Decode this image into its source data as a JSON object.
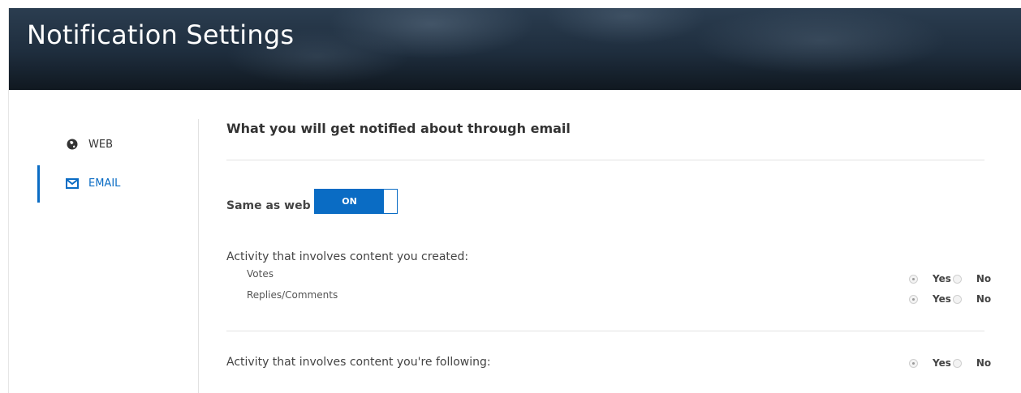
{
  "header": {
    "title": "Notification Settings"
  },
  "sidebar": {
    "items": [
      {
        "label": "WEB",
        "icon": "globe-icon",
        "active": false
      },
      {
        "label": "EMAIL",
        "icon": "envelope-icon",
        "active": true
      }
    ]
  },
  "main": {
    "section_title": "What you will get notified about through email",
    "same_as_web": {
      "label": "Same as web",
      "toggle_state": "ON"
    },
    "groups": [
      {
        "label": "Activity that involves content you created:",
        "options": [
          {
            "label": "Votes",
            "yes": "Yes",
            "no": "No",
            "selected": "Yes"
          },
          {
            "label": "Replies/Comments",
            "yes": "Yes",
            "no": "No",
            "selected": "Yes"
          }
        ]
      },
      {
        "label": "Activity that involves content you're following:",
        "yes": "Yes",
        "no": "No",
        "selected": "Yes"
      }
    ]
  },
  "colors": {
    "accent": "#0a6cc4",
    "banner": "#1e2d3d"
  }
}
